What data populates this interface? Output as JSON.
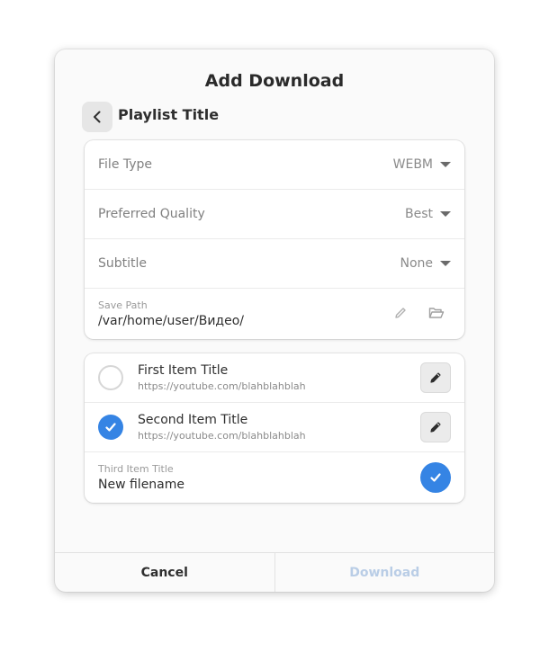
{
  "dialog": {
    "title": "Add Download",
    "subtitle": "Playlist Title"
  },
  "settings": {
    "file_type": {
      "label": "File Type",
      "value": "WEBM"
    },
    "quality": {
      "label": "Preferred Quality",
      "value": "Best"
    },
    "subtitle": {
      "label": "Subtitle",
      "value": "None"
    },
    "save_path": {
      "label": "Save Path",
      "value": "/var/home/user/Видео/"
    }
  },
  "items": [
    {
      "title": "First Item Title",
      "url": "https://youtube.com/blahblahblah",
      "checked": false
    },
    {
      "title": "Second Item Title",
      "url": "https://youtube.com/blahblahblah",
      "checked": true
    }
  ],
  "rename": {
    "caption": "Third Item Title",
    "value": "New filename"
  },
  "footer": {
    "cancel_label": "Cancel",
    "download_label": "Download"
  },
  "colors": {
    "accent": "#3584e4",
    "disabled_text": "#b9cde6"
  },
  "icons": [
    "chevron-left-icon",
    "dropdown-arrow-icon",
    "pencil-icon",
    "folder-open-icon",
    "checkmark-icon"
  ]
}
